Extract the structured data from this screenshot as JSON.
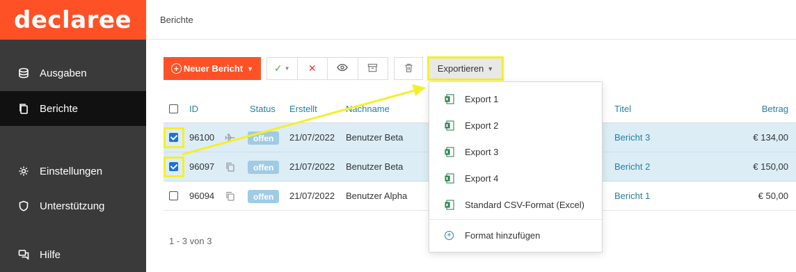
{
  "brand": {
    "logo": "declaree"
  },
  "sidebar": {
    "items": [
      {
        "label": "Ausgaben",
        "icon": "coins-icon"
      },
      {
        "label": "Berichte",
        "icon": "documents-icon"
      },
      {
        "label": "Einstellungen",
        "icon": "gear-icon"
      },
      {
        "label": "Unterstützung",
        "icon": "shield-icon"
      },
      {
        "label": "Hilfe",
        "icon": "chat-icon"
      }
    ]
  },
  "header": {
    "breadcrumb": "Berichte"
  },
  "toolbar": {
    "new_label": "Neuer Bericht",
    "export_label": "Exportieren"
  },
  "table": {
    "columns": {
      "id": "ID",
      "status": "Status",
      "created": "Erstellt",
      "lastname": "Nachname",
      "title": "Titel",
      "amount": "Betrag"
    },
    "rows": [
      {
        "id": "96100",
        "status": "offen",
        "created": "21/07/2022",
        "lastname": "Benutzer Beta",
        "title": "Bericht 3",
        "amount": "€ 134,00",
        "checked": true,
        "icon": "airplane-icon"
      },
      {
        "id": "96097",
        "status": "offen",
        "created": "21/07/2022",
        "lastname": "Benutzer Beta",
        "title": "Bericht 2",
        "amount": "€ 150,00",
        "checked": true,
        "icon": "copy-icon"
      },
      {
        "id": "96094",
        "status": "offen",
        "created": "21/07/2022",
        "lastname": "Benutzer Alpha",
        "title": "Bericht 1",
        "amount": "€ 50,00",
        "checked": false,
        "icon": "copy-icon"
      }
    ]
  },
  "pager": {
    "text": "1 - 3 von 3"
  },
  "export_menu": {
    "items": [
      "Export 1",
      "Export 2",
      "Export 3",
      "Export 4",
      "Standard CSV-Format (Excel)"
    ],
    "add_label": "Format hinzufügen"
  },
  "colors": {
    "brand": "#ff5126",
    "sidebar": "#3a3a3a",
    "highlight": "#f5ef2a",
    "link": "#227fa0",
    "selected_row": "#dcedf6",
    "badge": "#9fcbe4"
  }
}
